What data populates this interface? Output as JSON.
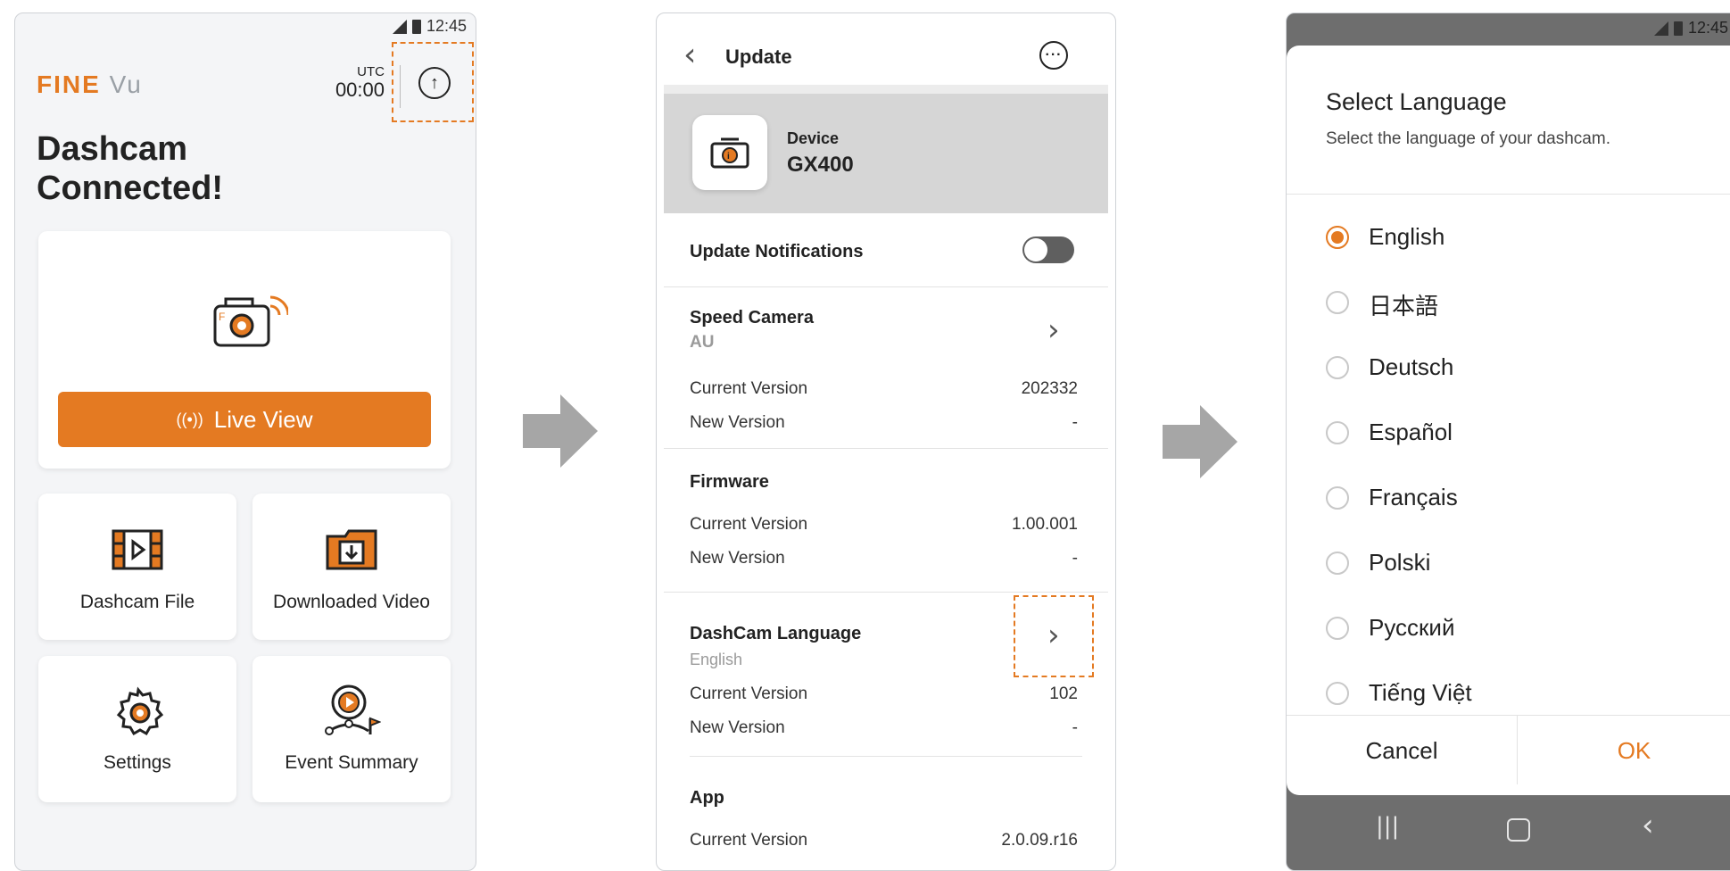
{
  "colors": {
    "accent": "#e47a22",
    "arrow": "#a6a6a6",
    "toggle_off": "#5f5f5f",
    "band": "#d6d6d6"
  },
  "screen1": {
    "status_time": "12:45",
    "logo_fine": "FINE",
    "logo_vu": "Vu",
    "utc_label": "UTC",
    "utc_time": "00:00",
    "upload_icon": "upload-circle-icon",
    "headline_line1": "Dashcam",
    "headline_line2": "Connected!",
    "live_view_label": "Live View",
    "tiles": [
      {
        "label": "Dashcam File",
        "icon": "film-icon"
      },
      {
        "label": "Downloaded Video",
        "icon": "download-folder-icon"
      },
      {
        "label": "Settings",
        "icon": "gear-icon"
      },
      {
        "label": "Event Summary",
        "icon": "event-summary-icon"
      }
    ]
  },
  "screen2": {
    "title": "Update",
    "device_label": "Device",
    "device_model": "GX400",
    "update_notifications_label": "Update Notifications",
    "speed_camera": {
      "title": "Speed Camera",
      "sub": "AU",
      "current_label": "Current Version",
      "current_value": "202332",
      "new_label": "New Version",
      "new_value": "-"
    },
    "firmware": {
      "title": "Firmware",
      "current_label": "Current Version",
      "current_value": "1.00.001",
      "new_label": "New Version",
      "new_value": "-"
    },
    "language": {
      "title": "DashCam Language",
      "sub": "English",
      "current_label": "Current Version",
      "current_value": "102",
      "new_label": "New Version",
      "new_value": "-"
    },
    "app": {
      "title": "App",
      "current_label": "Current Version",
      "current_value": "2.0.09.r16"
    }
  },
  "screen3": {
    "status_time": "12:45",
    "title": "Select Language",
    "subtitle": "Select the language of your dashcam.",
    "languages": [
      "English",
      "日本語",
      "Deutsch",
      "Español",
      "Français",
      "Polski",
      "Русский",
      "Tiếng Việt"
    ],
    "selected_index": 0,
    "cancel_label": "Cancel",
    "ok_label": "OK"
  }
}
